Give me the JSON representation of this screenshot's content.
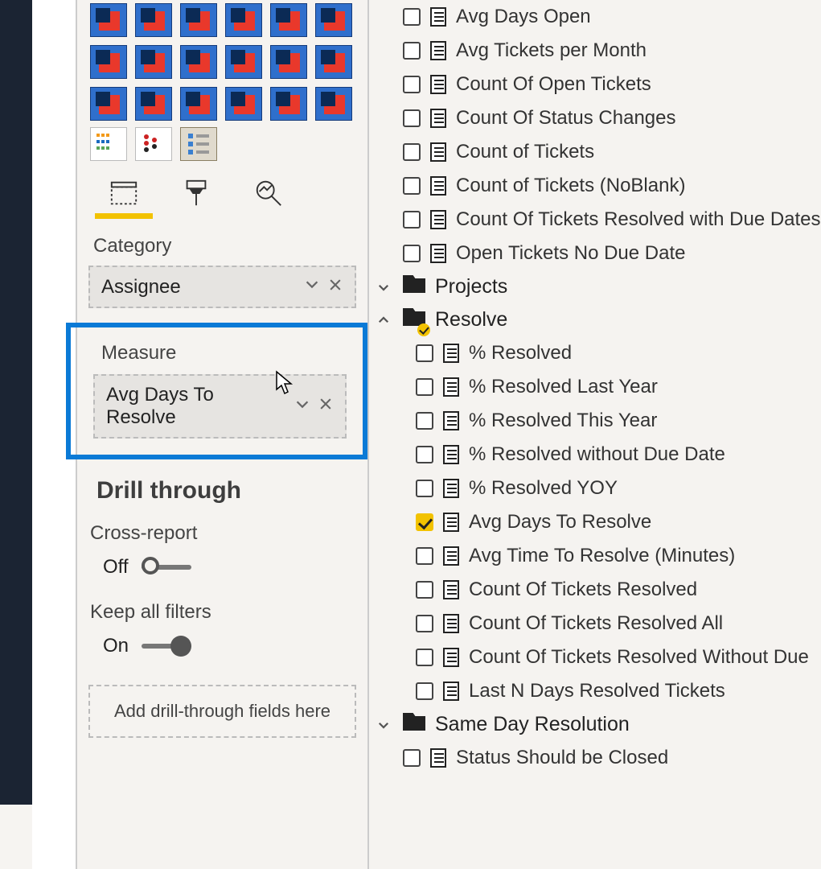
{
  "viz_pane": {
    "category_label": "Category",
    "category_value": "Assignee",
    "measure_label": "Measure",
    "measure_value": "Avg Days To Resolve",
    "drill_heading": "Drill through",
    "cross_report_label": "Cross-report",
    "cross_report_value": "Off",
    "keep_filters_label": "Keep all filters",
    "keep_filters_value": "On",
    "drill_drop_placeholder": "Add drill-through fields here"
  },
  "fields": {
    "top_measures": [
      "Avg Days Open",
      "Avg Tickets per Month",
      "Count Of Open Tickets",
      "Count Of Status Changes",
      "Count of Tickets",
      "Count of Tickets (NoBlank)",
      "Count Of Tickets Resolved with Due Dates",
      "Open Tickets No Due Date"
    ],
    "tables": [
      {
        "name": "Projects",
        "expanded": false,
        "has_check": false
      },
      {
        "name": "Resolve",
        "expanded": true,
        "has_check": true,
        "items": [
          {
            "label": "% Resolved",
            "checked": false
          },
          {
            "label": "% Resolved Last Year",
            "checked": false
          },
          {
            "label": "% Resolved This Year",
            "checked": false
          },
          {
            "label": "% Resolved without Due Date",
            "checked": false
          },
          {
            "label": "% Resolved YOY",
            "checked": false
          },
          {
            "label": "Avg Days To Resolve",
            "checked": true
          },
          {
            "label": "Avg Time To Resolve (Minutes)",
            "checked": false
          },
          {
            "label": "Count Of Tickets Resolved",
            "checked": false
          },
          {
            "label": "Count Of Tickets Resolved All",
            "checked": false
          },
          {
            "label": "Count Of Tickets Resolved Without Due",
            "checked": false
          },
          {
            "label": "Last N Days Resolved Tickets",
            "checked": false
          }
        ]
      },
      {
        "name": "Same Day Resolution",
        "expanded": false,
        "has_check": false
      },
      {
        "name": "bottom_items",
        "items": [
          {
            "label": "Status Should be Closed",
            "checked": false
          }
        ]
      }
    ]
  }
}
